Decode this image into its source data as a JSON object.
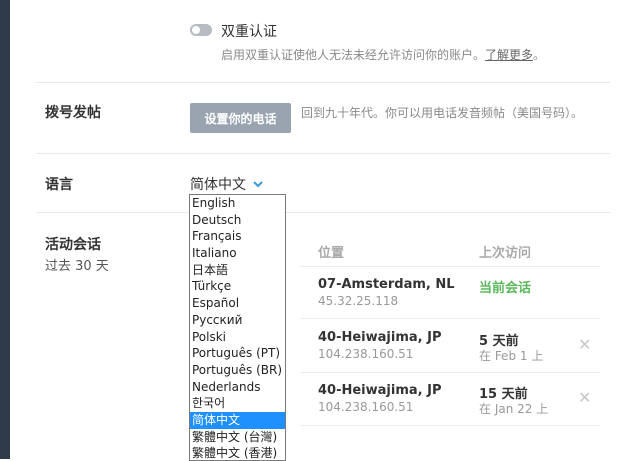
{
  "two_factor": {
    "title": "双重认证",
    "description": "启用双重认证使他人无法未经允许访问你的账户。",
    "learn_more": "了解更多",
    "suffix": "。"
  },
  "dial": {
    "label": "拨号发帖",
    "button": "设置你的电话",
    "description": "回到九十年代。你可以用电话发音频帖（美国号码）。"
  },
  "language": {
    "label": "语言",
    "selected": "简体中文",
    "options": [
      "English",
      "Deutsch",
      "Français",
      "Italiano",
      "日本語",
      "Türkçe",
      "Español",
      "Русский",
      "Polski",
      "Português (PT)",
      "Português (BR)",
      "Nederlands",
      "한국어",
      "简体中文",
      "繁體中文 (台灣)",
      "繁體中文 (香港)"
    ]
  },
  "sessions": {
    "label": "活动会话",
    "subtitle": "过去 30 天",
    "columns": {
      "location": "位置",
      "last_visit": "上次访问"
    },
    "rows": [
      {
        "location": "07-Amsterdam, NL",
        "ip": "45.32.25.118",
        "visit": "当前会话",
        "visit_sub": "",
        "current": true
      },
      {
        "location": "40-Heiwajima, JP",
        "ip": "104.238.160.51",
        "visit": "5 天前",
        "visit_sub": "在 Feb 1 上",
        "current": false
      },
      {
        "location": "40-Heiwajima, JP",
        "ip": "104.238.160.51",
        "visit": "15 天前",
        "visit_sub": "在 Jan 22 上",
        "current": false
      }
    ],
    "close_glyph": "✕"
  },
  "colors": {
    "accent": "#5cb85c",
    "button_gray": "#9aa4b0",
    "selected_blue": "#1e90ff",
    "chevron": "#3a9ad9"
  }
}
